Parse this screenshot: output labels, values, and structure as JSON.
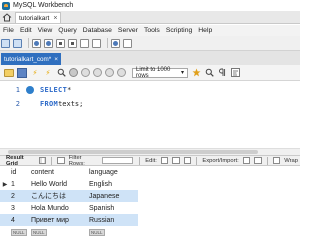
{
  "window": {
    "title": "MySQL Workbench"
  },
  "tabs": {
    "connection": "tutorialkart",
    "connection_close": "×"
  },
  "menu": [
    "File",
    "Edit",
    "View",
    "Query",
    "Database",
    "Server",
    "Tools",
    "Scripting",
    "Help"
  ],
  "query_tab": {
    "label": "tutorialkart_com*",
    "close": "×"
  },
  "toolbar2": {
    "limit_label": "Limit to 1000 rows"
  },
  "editor": {
    "lines": [
      {
        "number": "1",
        "keyword": "SELECT",
        "rest": " *"
      },
      {
        "number": "2",
        "keyword": "FROM",
        "rest": " texts;"
      }
    ]
  },
  "result_bar": {
    "result_grid": "Result Grid",
    "filter_rows": "Filter Rows:",
    "edit": "Edit:",
    "export_import": "Export/Import:",
    "wrap": "Wrap"
  },
  "grid": {
    "columns": [
      "id",
      "content",
      "language"
    ],
    "rows": [
      [
        "1",
        "Hello World",
        "English"
      ],
      [
        "2",
        "こんにちは",
        "Japanese"
      ],
      [
        "3",
        "Hola Mundo",
        "Spanish"
      ],
      [
        "4",
        "Привет мир",
        "Russian"
      ]
    ],
    "null_label": "NULL",
    "selected_row": 1
  },
  "colors": {
    "accent": "#2f6fbf",
    "keyword": "#2b69c8",
    "selection": "#cfe3f7"
  }
}
